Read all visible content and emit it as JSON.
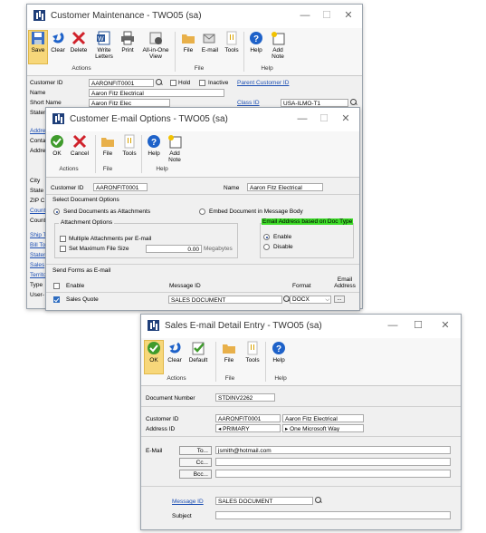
{
  "win1": {
    "title": "Customer Maintenance  -  TWO05 (sa)",
    "ribbon": {
      "buttons": [
        "Save",
        "Clear",
        "Delete",
        "Write Letters",
        "Print",
        "All-in-One View",
        "File",
        "E-mail",
        "Tools",
        "Help",
        "Add Note"
      ],
      "groups": [
        "Actions",
        "File",
        "Help"
      ]
    },
    "fields": {
      "customer_id_label": "Customer ID",
      "customer_id": "AARONFIT0001",
      "hold_label": "Hold",
      "inactive_label": "Inactive",
      "parent_customer_link": "Parent Customer ID",
      "name_label": "Name",
      "name": "Aaron Fitz Electrical",
      "short_name_label": "Short Name",
      "short_name": "Aaron Fitz Elec",
      "class_id_link": "Class ID",
      "class_id": "USA-ILMO-T1",
      "statement_label": "Statem"
    },
    "side_labels": [
      "Addre",
      "Conta",
      "Addre",
      "City",
      "State",
      "ZIP C",
      "Count",
      "Count"
    ],
    "side_links": [
      "Ship T",
      "Bill To",
      "Statem",
      "Sales",
      "Territo"
    ],
    "side_tail": [
      "Type",
      "User-"
    ]
  },
  "win2": {
    "title": "Customer E-mail Options  -  TWO05 (sa)",
    "ribbon": {
      "buttons": [
        "OK",
        "Cancel",
        "File",
        "Tools",
        "Help",
        "Add Note"
      ],
      "groups": [
        "Actions",
        "File",
        "Help"
      ]
    },
    "customer_id_label": "Customer ID",
    "customer_id": "AARONFIT0001",
    "name_label": "Name",
    "name": "Aaron Fitz Electrical",
    "select_doc_options": "Select Document Options",
    "send_as_attachments": "Send Documents as Attachments",
    "embed_in_body": "Embed Document in Message Body",
    "attachment_options": "Attachment Options",
    "multiple_attachments": "Multiple Attachments per E-mail",
    "set_max_file_size": "Set Maximum File Size",
    "max_size_value": "0.00",
    "megabytes": "Megabytes",
    "email_based_doc_type": "Email Address based on Doc Type",
    "enable": "Enable",
    "disable": "Disable",
    "send_forms": "Send Forms as E-mail",
    "col_enable": "Enable",
    "col_message_id": "Message ID",
    "col_format": "Format",
    "col_email_address": "Email Address",
    "row_label": "Sales Quote",
    "row_message_id": "SALES DOCUMENT",
    "row_format": "DOCX",
    "highlight_color": "#3ddc28"
  },
  "win3": {
    "title": "Sales E-mail Detail Entry  -  TWO05 (sa)",
    "ribbon": {
      "buttons": [
        "OK",
        "Clear",
        "Default",
        "File",
        "Tools",
        "Help"
      ],
      "groups": [
        "Actions",
        "File",
        "Help"
      ]
    },
    "document_number_label": "Document Number",
    "document_number": "STDINV2262",
    "customer_id_label": "Customer ID",
    "customer_id": "AARONFIT0001",
    "customer_name": "Aaron Fitz Electrical",
    "address_id_label": "Address ID",
    "address_id": "PRIMARY",
    "address_name": "One Microsoft Way",
    "email_label": "E-Mail",
    "to_button": "To...",
    "to_value": "jsmith@hotmail.com",
    "cc_button": "Cc...",
    "bcc_button": "Bcc...",
    "message_id_link": "Message ID",
    "message_id": "SALES DOCUMENT",
    "subject_label": "Subject"
  }
}
